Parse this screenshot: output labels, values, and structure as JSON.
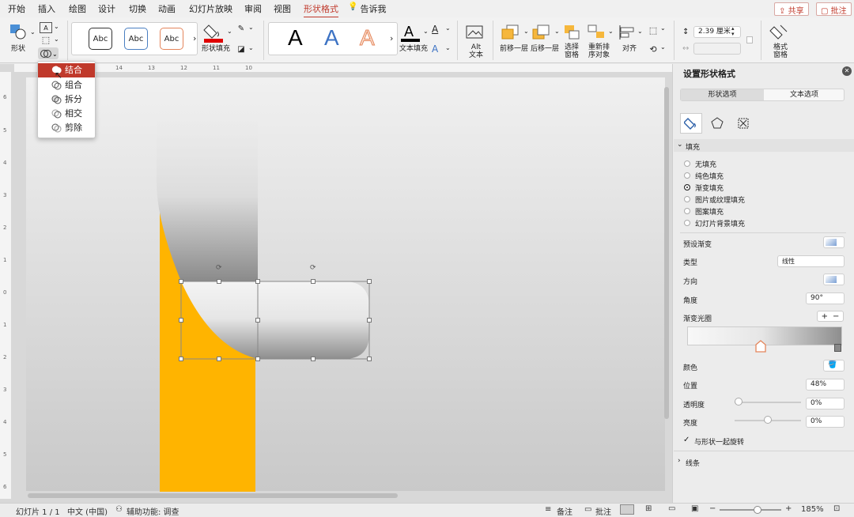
{
  "menu": {
    "tabs": [
      "开始",
      "插入",
      "绘图",
      "设计",
      "切换",
      "动画",
      "幻灯片放映",
      "审阅",
      "视图",
      "形状格式"
    ],
    "tell_me": "告诉我",
    "share": "共享",
    "comments": "批注"
  },
  "ribbon": {
    "shape_label": "形状",
    "style_abc": [
      "Abc",
      "Abc",
      "Abc"
    ],
    "shape_fill": "形状填充",
    "wordart_letter": "A",
    "text_fill": "文本填充",
    "alt_text": "Alt\n文本",
    "bring_forward": "前移一层",
    "send_backward": "后移一层",
    "selection_pane": "选择\n窗格",
    "reorder": "重新排\n序对象",
    "align": "对齐",
    "height_value": "2.39 厘米",
    "format_pane": "格式\n窗格",
    "chevron": "›"
  },
  "merge_menu": {
    "items": [
      "结合",
      "组合",
      "拆分",
      "相交",
      "剪除"
    ],
    "selected_index": 0
  },
  "ruler": {
    "top_numbers": [
      "14",
      "13",
      "12",
      "11",
      "10"
    ],
    "left_numbers": [
      "6",
      "5",
      "4",
      "3",
      "2",
      "1",
      "0",
      "1",
      "2",
      "3",
      "4",
      "5",
      "6",
      "7",
      "8"
    ]
  },
  "pane": {
    "title": "设置形状格式",
    "tab_shape": "形状选项",
    "tab_text": "文本选项",
    "section_fill": "填充",
    "fill_options": [
      "无填充",
      "纯色填充",
      "渐变填充",
      "图片或纹理填充",
      "图案填充",
      "幻灯片背景填充"
    ],
    "fill_selected_index": 2,
    "preset_gradient": "预设渐变",
    "type_label": "类型",
    "type_value": "线性",
    "direction_label": "方向",
    "angle_label": "角度",
    "angle_value": "90°",
    "stops_label": "渐变光圈",
    "color_label": "颜色",
    "position_label": "位置",
    "position_value": "48%",
    "transparency_label": "透明度",
    "transparency_value": "0%",
    "brightness_label": "亮度",
    "brightness_value": "0%",
    "rotate_with_shape": "与形状一起旋转",
    "section_line": "线条"
  },
  "status": {
    "slide": "幻灯片 1 / 1",
    "language": "中文 (中国)",
    "accessibility": "辅助功能: 调查",
    "notes": "备注",
    "comments": "批注",
    "zoom": "185%"
  },
  "colors": {
    "accent": "#c0392b",
    "orange_shape": "#ffb400",
    "fill_red": "#e00000"
  }
}
